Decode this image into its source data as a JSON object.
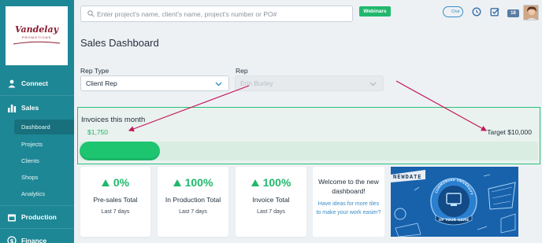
{
  "brand": {
    "logo_text": "Vandelay",
    "logo_sub": "PROMOTIONS"
  },
  "sidebar": {
    "items": [
      {
        "label": "Connect",
        "icon": "people-icon"
      },
      {
        "label": "Sales",
        "icon": "bar-chart-icon"
      },
      {
        "label": "Production",
        "icon": "calendar-icon"
      },
      {
        "label": "Finance",
        "icon": "dollar-icon"
      }
    ],
    "sales_sub": [
      {
        "label": "Dashboard",
        "active": true
      },
      {
        "label": "Projects"
      },
      {
        "label": "Clients"
      },
      {
        "label": "Shops"
      },
      {
        "label": "Analytics"
      }
    ]
  },
  "topbar": {
    "search_placeholder": "Enter project's name, client's name, project's number or PO#",
    "webinars": "Webinars",
    "chat": "Chat",
    "badge": "18"
  },
  "page": {
    "title": "Sales Dashboard",
    "rep_type_label": "Rep Type",
    "rep_type_value": "Client Rep",
    "rep_label": "Rep",
    "rep_value": "Erin Burley"
  },
  "invoices": {
    "title": "Invoices this month",
    "amount": "$1,750",
    "target": "Target $10,000",
    "progress_fraction": 0.175
  },
  "cards": [
    {
      "pct": "0%",
      "title": "Pre-sales Total",
      "sub": "Last 7 days"
    },
    {
      "pct": "100%",
      "title": "In Production Total",
      "sub": "Last 7 days"
    },
    {
      "pct": "100%",
      "title": "Invoice Total",
      "sub": "Last 7 days"
    }
  ],
  "welcome": {
    "title": "Welcome to the new dashboard!",
    "link": "Have ideas for more tiles to make your work easier?"
  },
  "promo": {
    "banner": "NEWDATE",
    "arc_text": "COMMONSKU UNIVERSITY",
    "ribbon": "UP YOUR GAME"
  },
  "colors": {
    "sidebar": "#1d8795",
    "accent_green": "#21b86d",
    "link_blue": "#3a8dc8",
    "annotation_arrow": "#c2185b"
  }
}
